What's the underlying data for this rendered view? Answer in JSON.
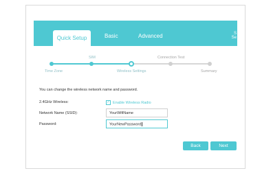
{
  "tabs": {
    "quick_setup": "Quick Setup",
    "basic": "Basic",
    "advanced": "Advanced"
  },
  "header_edge": {
    "line1": "S",
    "line2": "Se"
  },
  "steps": {
    "time_zone": "Time Zone",
    "sim": "SIM",
    "wireless_settings": "Wireless Settings",
    "connection_test": "Connection Test",
    "summary": "Summary"
  },
  "intro_text": "You can change the wireless network name and password.",
  "wireless": {
    "band_label": "2.4GHz Wireless:",
    "enable_label": "Enable Wireless Radio",
    "check_glyph": "✓",
    "ssid_label": "Network Name (SSID):",
    "ssid_value": "YourWifiName",
    "password_label": "Password:",
    "password_value": "YourNewPassword"
  },
  "buttons": {
    "back": "Back",
    "next": "Next"
  },
  "colors": {
    "accent": "#4ec8d2",
    "track": "#d7d7d7"
  }
}
